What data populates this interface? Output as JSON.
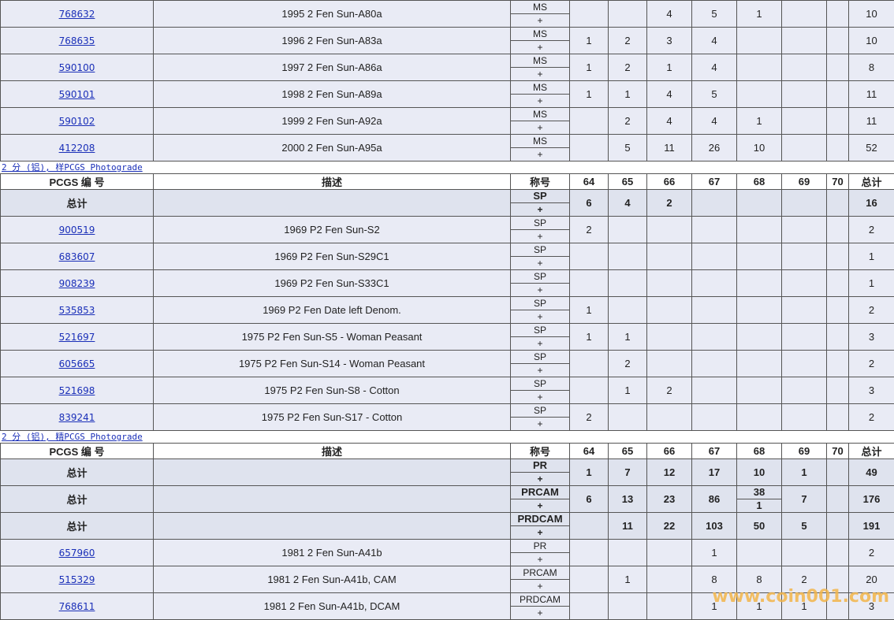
{
  "columns": {
    "pcgs_no": "PCGS 编 号",
    "desc": "描述",
    "designation": "称号",
    "g64": "64",
    "g65": "65",
    "g66": "66",
    "g67": "67",
    "g68": "68",
    "g69": "69",
    "g70": "70",
    "total": "总计"
  },
  "total_label": "总计",
  "plus": "+",
  "section1_rows": [
    {
      "id": "768632",
      "desc": "1995 2 Fen Sun-A80a",
      "des": "MS",
      "g64": "",
      "g65": "",
      "g66": "4",
      "g67": "5",
      "g68": "1",
      "g69": "",
      "g70": "",
      "total": "10"
    },
    {
      "id": "768635",
      "desc": "1996 2 Fen Sun-A83a",
      "des": "MS",
      "g64": "1",
      "g65": "2",
      "g66": "3",
      "g67": "4",
      "g68": "",
      "g69": "",
      "g70": "",
      "total": "10"
    },
    {
      "id": "590100",
      "desc": "1997 2 Fen Sun-A86a",
      "des": "MS",
      "g64": "1",
      "g65": "2",
      "g66": "1",
      "g67": "4",
      "g68": "",
      "g69": "",
      "g70": "",
      "total": "8"
    },
    {
      "id": "590101",
      "desc": "1998 2 Fen Sun-A89a",
      "des": "MS",
      "g64": "1",
      "g65": "1",
      "g66": "4",
      "g67": "5",
      "g68": "",
      "g69": "",
      "g70": "",
      "total": "11"
    },
    {
      "id": "590102",
      "desc": "1999 2 Fen Sun-A92a",
      "des": "MS",
      "g64": "",
      "g65": "2",
      "g66": "4",
      "g67": "4",
      "g68": "1",
      "g69": "",
      "g70": "",
      "total": "11"
    },
    {
      "id": "412208",
      "desc": "2000 2 Fen Sun-A95a",
      "des": "MS",
      "g64": "",
      "g65": "5",
      "g66": "11",
      "g67": "26",
      "g68": "10",
      "g69": "",
      "g70": "",
      "total": "52"
    }
  ],
  "section2": {
    "title": "2 分 (铝), 样PCGS Photograde",
    "totals": [
      {
        "des": "SP",
        "g64": "6",
        "g65": "4",
        "g66": "2",
        "g67": "",
        "g68": "",
        "g69": "",
        "g70": "",
        "total": "16"
      }
    ],
    "rows": [
      {
        "id": "900519",
        "desc": "1969 P2 Fen Sun-S2",
        "des": "SP",
        "g64": "2",
        "g65": "",
        "g66": "",
        "g67": "",
        "g68": "",
        "g69": "",
        "g70": "",
        "total": "2"
      },
      {
        "id": "683607",
        "desc": "1969 P2 Fen Sun-S29C1",
        "des": "SP",
        "g64": "",
        "g65": "",
        "g66": "",
        "g67": "",
        "g68": "",
        "g69": "",
        "g70": "",
        "total": "1"
      },
      {
        "id": "908239",
        "desc": "1969 P2 Fen Sun-S33C1",
        "des": "SP",
        "g64": "",
        "g65": "",
        "g66": "",
        "g67": "",
        "g68": "",
        "g69": "",
        "g70": "",
        "total": "1"
      },
      {
        "id": "535853",
        "desc": "1969 P2 Fen Date left Denom.",
        "des": "SP",
        "g64": "1",
        "g65": "",
        "g66": "",
        "g67": "",
        "g68": "",
        "g69": "",
        "g70": "",
        "total": "2"
      },
      {
        "id": "521697",
        "desc": "1975 P2 Fen Sun-S5 - Woman Peasant",
        "des": "SP",
        "g64": "1",
        "g65": "1",
        "g66": "",
        "g67": "",
        "g68": "",
        "g69": "",
        "g70": "",
        "total": "3"
      },
      {
        "id": "605665",
        "desc": "1975 P2 Fen Sun-S14 - Woman Peasant",
        "des": "SP",
        "g64": "",
        "g65": "2",
        "g66": "",
        "g67": "",
        "g68": "",
        "g69": "",
        "g70": "",
        "total": "2"
      },
      {
        "id": "521698",
        "desc": "1975 P2 Fen Sun-S8 - Cotton",
        "des": "SP",
        "g64": "",
        "g65": "1",
        "g66": "2",
        "g67": "",
        "g68": "",
        "g69": "",
        "g70": "",
        "total": "3"
      },
      {
        "id": "839241",
        "desc": "1975 P2 Fen Sun-S17 - Cotton",
        "des": "SP",
        "g64": "2",
        "g65": "",
        "g66": "",
        "g67": "",
        "g68": "",
        "g69": "",
        "g70": "",
        "total": "2"
      }
    ]
  },
  "section3": {
    "title": "2 分 (铝), 精PCGS Photograde",
    "totals": [
      {
        "des": "PR",
        "g64": "1",
        "g65": "7",
        "g66": "12",
        "g67": "17",
        "g68": "10",
        "g69": "1",
        "g70": "",
        "total": "49"
      },
      {
        "des": "PRCAM",
        "g64": "6",
        "g65": "13",
        "g66": "23",
        "g67": "86",
        "g68": "38",
        "g68plus": "1",
        "g69": "7",
        "g70": "",
        "total": "176"
      },
      {
        "des": "PRDCAM",
        "g64": "",
        "g65": "11",
        "g66": "22",
        "g67": "103",
        "g68": "50",
        "g69": "5",
        "g70": "",
        "total": "191"
      }
    ],
    "rows": [
      {
        "id": "657960",
        "desc": "1981 2 Fen Sun-A41b",
        "des": "PR",
        "g64": "",
        "g65": "",
        "g66": "",
        "g67": "1",
        "g68": "",
        "g69": "",
        "g70": "",
        "total": "2"
      },
      {
        "id": "515329",
        "desc": "1981 2 Fen Sun-A41b, CAM",
        "des": "PRCAM",
        "g64": "",
        "g65": "1",
        "g66": "",
        "g67": "8",
        "g68": "8",
        "g69": "2",
        "g70": "",
        "total": "20"
      },
      {
        "id": "768611",
        "desc": "1981 2 Fen Sun-A41b, DCAM",
        "des": "PRDCAM",
        "g64": "",
        "g65": "",
        "g66": "",
        "g67": "1",
        "g68": "1",
        "g69": "1",
        "g70": "",
        "total": "3"
      }
    ]
  },
  "watermark": "www.coin001.com"
}
